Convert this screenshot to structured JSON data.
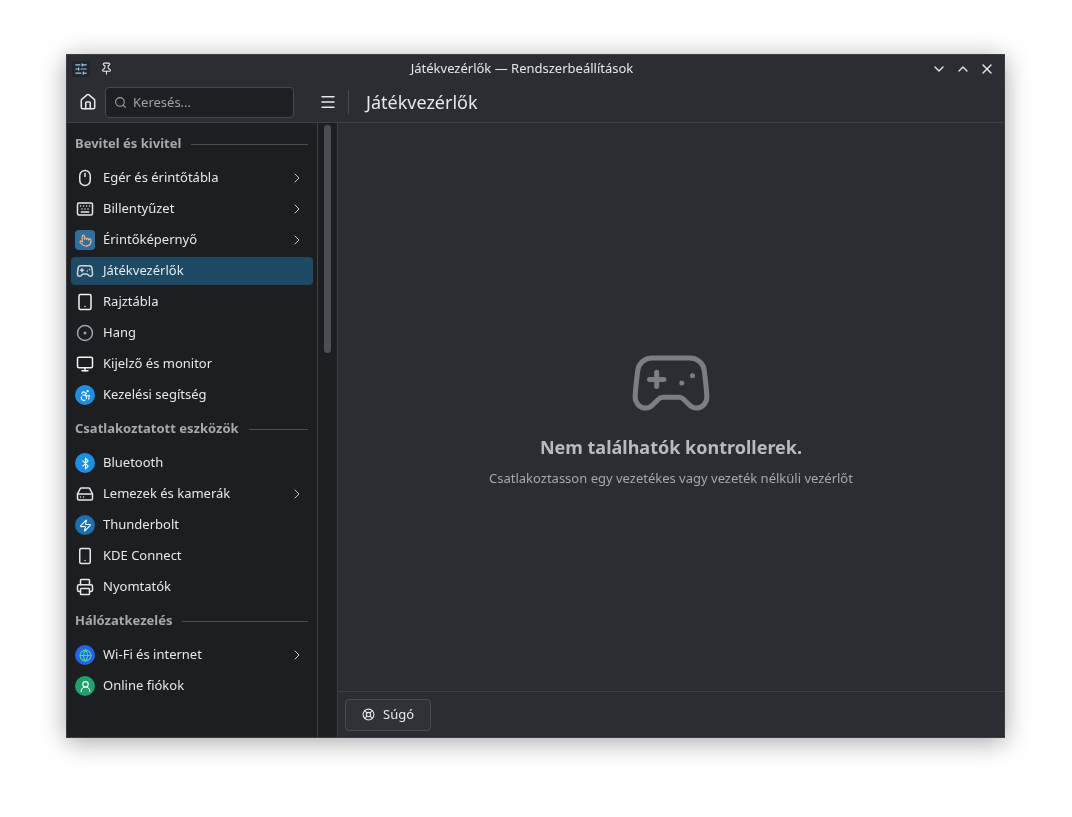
{
  "window": {
    "title": "Játékvezérlők — Rendszerbeállítások"
  },
  "toolbar": {
    "search": {
      "placeholder": "Keresés..."
    },
    "page_title": "Játékvezérlők"
  },
  "sidebar": {
    "sections": [
      {
        "heading": "Bevitel és kivitel",
        "items": [
          {
            "label": "Egér és érintőtábla",
            "selected": false,
            "submenu": true
          },
          {
            "label": "Billentyűzet",
            "selected": false,
            "submenu": true
          },
          {
            "label": "Érintőképernyő",
            "selected": false,
            "submenu": true
          },
          {
            "label": "Játékvezérlők",
            "selected": true,
            "submenu": false
          },
          {
            "label": "Rajztábla",
            "selected": false,
            "submenu": false
          },
          {
            "label": "Hang",
            "selected": false,
            "submenu": false
          },
          {
            "label": "Kijelző és monitor",
            "selected": false,
            "submenu": false
          },
          {
            "label": "Kezelési segítség",
            "selected": false,
            "submenu": false
          }
        ]
      },
      {
        "heading": "Csatlakoztatott eszközök",
        "items": [
          {
            "label": "Bluetooth",
            "selected": false,
            "submenu": false
          },
          {
            "label": "Lemezek és kamerák",
            "selected": false,
            "submenu": true
          },
          {
            "label": "Thunderbolt",
            "selected": false,
            "submenu": false
          },
          {
            "label": "KDE Connect",
            "selected": false,
            "submenu": false
          },
          {
            "label": "Nyomtatók",
            "selected": false,
            "submenu": false
          }
        ]
      },
      {
        "heading": "Hálózatkezelés",
        "items": [
          {
            "label": "Wi-Fi és internet",
            "selected": false,
            "submenu": true
          },
          {
            "label": "Online fiókok",
            "selected": false,
            "submenu": false
          }
        ]
      }
    ]
  },
  "content": {
    "heading": "Nem találhatók kontrollerek.",
    "message": "Csatlakoztasson egy vezetékes vagy vezeték nélküli vezérlőt"
  },
  "footer": {
    "buttons": [
      "Súgó"
    ]
  }
}
